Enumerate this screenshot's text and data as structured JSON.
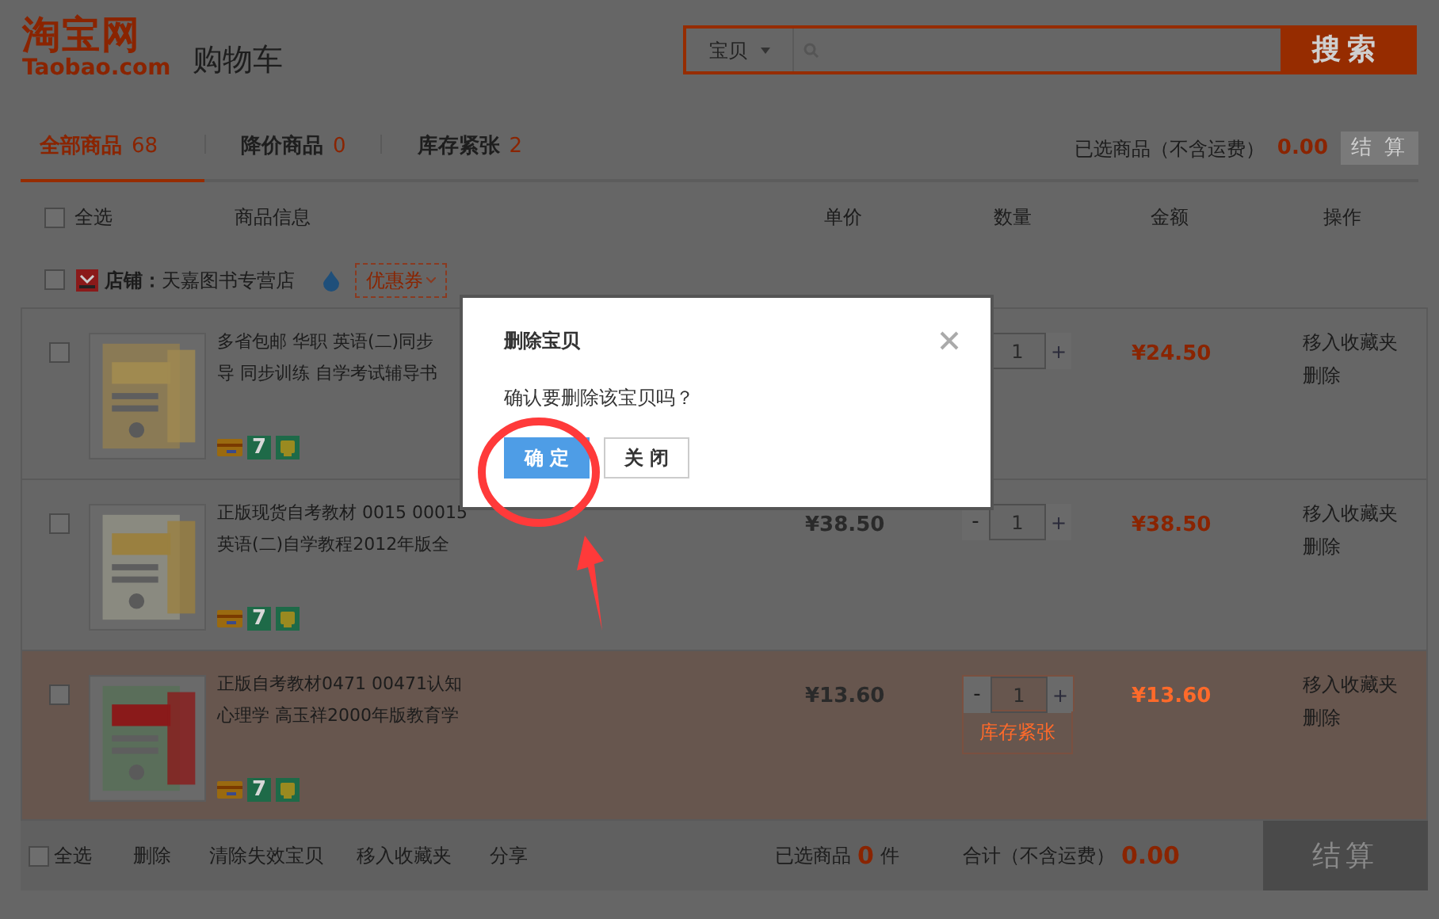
{
  "header": {
    "logo": "淘宝网",
    "logo_sub": "Taobao.com",
    "title": "购物车",
    "search": {
      "scope": "宝贝",
      "button": "搜索"
    }
  },
  "tabs": [
    {
      "label": "全部商品",
      "count": "68",
      "selected": true
    },
    {
      "label": "降价商品",
      "count": "0",
      "selected": false
    },
    {
      "label": "库存紧张",
      "count": "2",
      "selected": false
    }
  ],
  "summary": {
    "label": "已选商品（不含运费）",
    "amount": "0.00",
    "button": "结 算"
  },
  "columns": {
    "select_all": "全选",
    "checked": false,
    "labels": [
      "商品信息",
      "单价",
      "数量",
      "金额",
      "操作"
    ]
  },
  "shop": {
    "checked": false,
    "label": "**店铺：**天嘉图书专营店",
    "coupon": "优惠券"
  },
  "items": [
    {
      "checked": false,
      "highlighted": false,
      "title": [
        "多省包邮 华职 英语(二)同步",
        "导 同步训练 自学考试辅导书"
      ],
      "quantity": "1",
      "plus": "+",
      "total": "¥24.50",
      "actions": [
        "移入收藏夹",
        "删除"
      ],
      "badges": [
        {
          "kind": "card"
        },
        {
          "kind": "digit",
          "text": "7"
        },
        {
          "kind": "shield"
        }
      ]
    },
    {
      "checked": false,
      "highlighted": false,
      "title": [
        "正版现货自考教材 0015 00015",
        "英语(二)自学教程2012年版全"
      ],
      "unit_price": "¥38.50",
      "minus": "-",
      "quantity": "1",
      "plus": "+",
      "total": "¥38.50",
      "actions": [
        "移入收藏夹",
        "删除"
      ],
      "badges": [
        {
          "kind": "card"
        },
        {
          "kind": "digit",
          "text": "7"
        },
        {
          "kind": "shield"
        }
      ]
    },
    {
      "checked": false,
      "highlighted": true,
      "title": [
        "正版自考教材0471 00471认知",
        "心理学 高玉祥2000年版教育学"
      ],
      "unit_price": "¥13.60",
      "minus": "-",
      "quantity": "1",
      "plus": "+",
      "stock_note": "库存紧张",
      "total": "¥13.60",
      "actions": [
        "移入收藏夹",
        "删除"
      ],
      "badges": [
        {
          "kind": "card"
        },
        {
          "kind": "digit",
          "text": "7"
        },
        {
          "kind": "shield"
        }
      ]
    }
  ],
  "footer": {
    "checked": false,
    "select_all": "全选",
    "actions": [
      "删除",
      "清除失效宝贝",
      "移入收藏夹",
      "分享"
    ],
    "selected_label": "已选商品",
    "selected_count": "0",
    "unit": "件",
    "total_label": "合计（不含运费）",
    "total": "0.00",
    "button": "结算"
  },
  "dialog": {
    "title": "删除宝贝",
    "message": "确认要删除该宝贝吗？",
    "confirm": "确 定",
    "cancel": "关 闭"
  }
}
